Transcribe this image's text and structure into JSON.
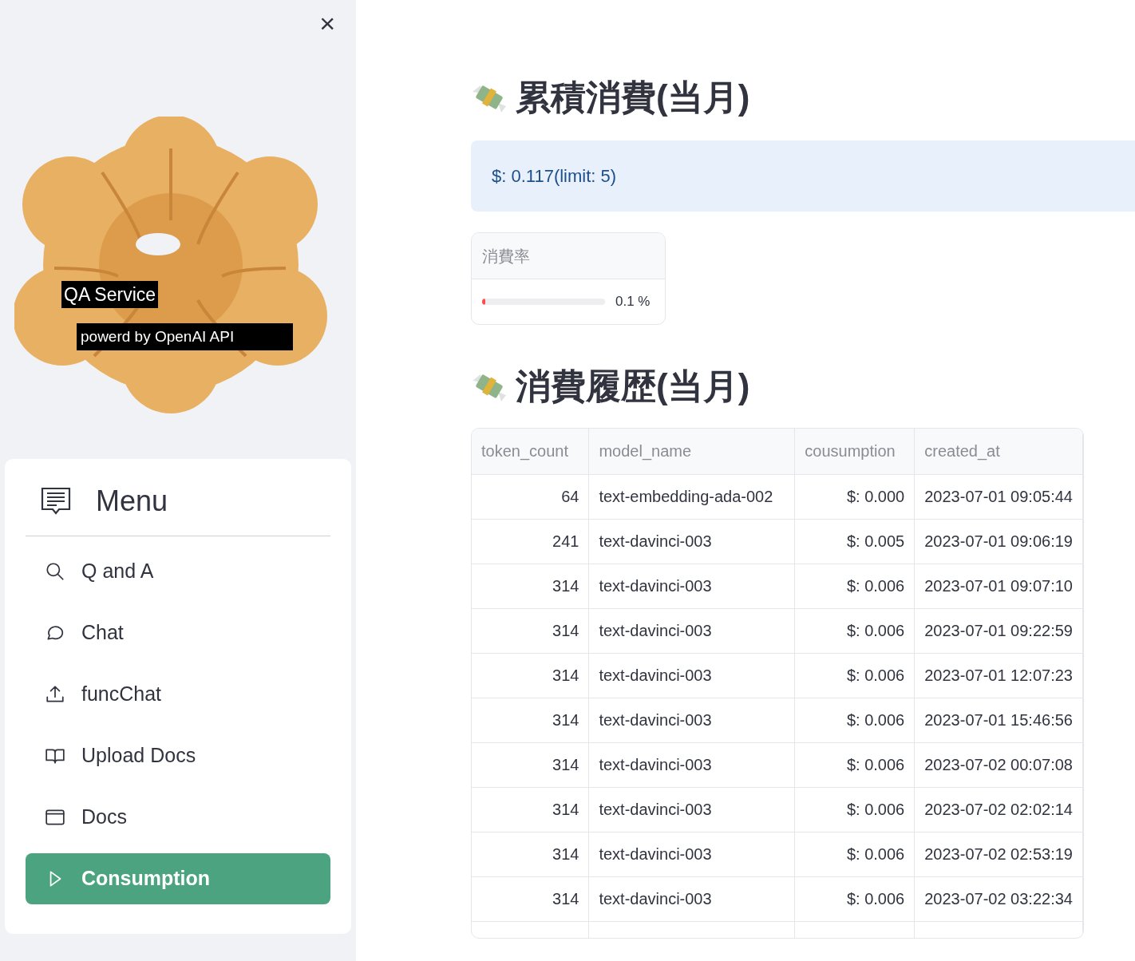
{
  "sidebar": {
    "close": "×",
    "logo": {
      "title": "QA Service",
      "subtitle": "powerd by OpenAI API"
    },
    "menu": {
      "title": "Menu",
      "items": [
        {
          "label": "Q and A",
          "selected": false
        },
        {
          "label": "Chat",
          "selected": false
        },
        {
          "label": "funcChat",
          "selected": false
        },
        {
          "label": "Upload Docs",
          "selected": false
        },
        {
          "label": "Docs",
          "selected": false
        },
        {
          "label": "Consumption",
          "selected": true
        }
      ]
    }
  },
  "main": {
    "total": {
      "heading": "累積消費(当月)",
      "info": "$: 0.117(limit: 5)",
      "metric": {
        "label": "消費率",
        "level": 0.001,
        "reading": "0.1 %"
      }
    },
    "history": {
      "heading": "消費履歴(当月)",
      "columns": [
        "token_count",
        "model_name",
        "cousumption",
        "created_at"
      ],
      "rows": [
        [
          "64",
          "text-embedding-ada-002",
          "$: 0.000",
          "2023-07-01 09:05:44"
        ],
        [
          "241",
          "text-davinci-003",
          "$: 0.005",
          "2023-07-01 09:06:19"
        ],
        [
          "314",
          "text-davinci-003",
          "$: 0.006",
          "2023-07-01 09:07:10"
        ],
        [
          "314",
          "text-davinci-003",
          "$: 0.006",
          "2023-07-01 09:22:59"
        ],
        [
          "314",
          "text-davinci-003",
          "$: 0.006",
          "2023-07-01 12:07:23"
        ],
        [
          "314",
          "text-davinci-003",
          "$: 0.006",
          "2023-07-01 15:46:56"
        ],
        [
          "314",
          "text-davinci-003",
          "$: 0.006",
          "2023-07-02 00:07:08"
        ],
        [
          "314",
          "text-davinci-003",
          "$: 0.006",
          "2023-07-02 02:02:14"
        ],
        [
          "314",
          "text-davinci-003",
          "$: 0.006",
          "2023-07-02 02:53:19"
        ],
        [
          "314",
          "text-davinci-003",
          "$: 0.006",
          "2023-07-02 03:22:34"
        ]
      ]
    }
  }
}
